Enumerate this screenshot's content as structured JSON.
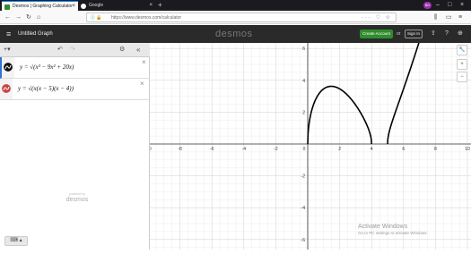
{
  "browser": {
    "tabs": [
      {
        "title": "Desmos | Graphing Calculator",
        "active": true,
        "favicon_color": "#2f8d2f"
      },
      {
        "title": "Google",
        "active": false,
        "favicon_color": "#e8e8e8"
      }
    ],
    "url": "https://www.desmos.com/calculator",
    "profile_initial": "BD"
  },
  "header": {
    "graph_title": "Untitled Graph",
    "logo": "desmos",
    "create_account_label": "Create Account",
    "or_label": "or",
    "sign_in_label": "Sign In"
  },
  "expressions": [
    {
      "latex_text": "y = √(x³ − 9x² + 20x)",
      "color": "#111111"
    },
    {
      "latex_text": "y = √(x(x − 5)(x − 4))",
      "color": "#c74440"
    }
  ],
  "footer": {
    "powered_by": "powered by",
    "brand": "desmos",
    "keyboard_label": "⌨ ▴"
  },
  "graph": {
    "x_ticks": [
      "-10",
      "-8",
      "-6",
      "-4",
      "-2",
      "0",
      "2",
      "4",
      "6",
      "8",
      "10"
    ],
    "y_ticks": [
      "6",
      "4",
      "2",
      "-2",
      "-4",
      "-6"
    ],
    "xlim": [
      -10.5,
      10.5
    ],
    "ylim": [
      -6.5,
      6.5
    ],
    "curve_color": "#000000",
    "grid": true
  },
  "watermark": {
    "title": "Activate Windows",
    "subtitle": "Go to PC settings to activate Windows."
  }
}
